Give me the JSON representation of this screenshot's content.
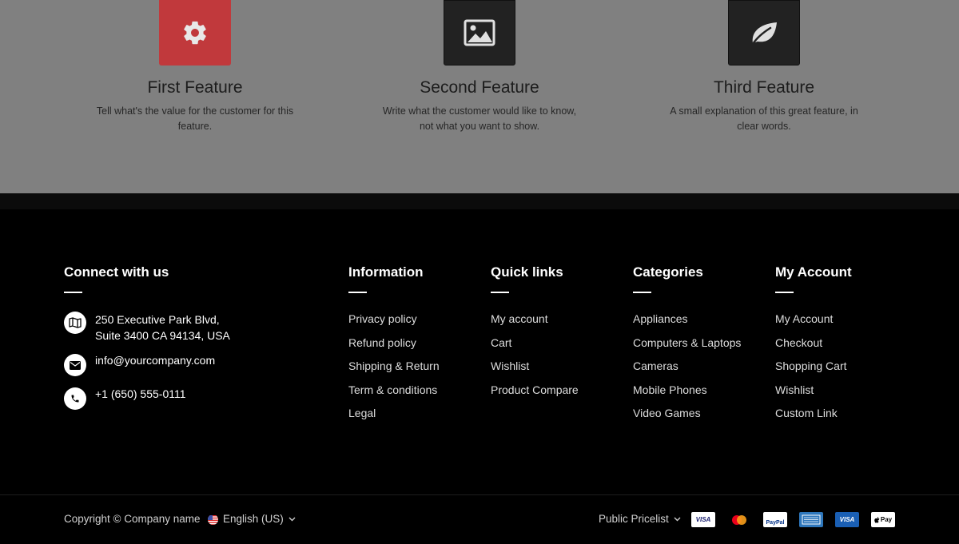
{
  "features": [
    {
      "title": "First Feature",
      "description": "Tell what's the value for the customer for this feature.",
      "icon": "gear-icon",
      "color": "#c1393c"
    },
    {
      "title": "Second Feature",
      "description": "Write what the customer would like to know, not what you want to show.",
      "icon": "image-icon",
      "color": "#222222"
    },
    {
      "title": "Third Feature",
      "description": "A small explanation of this great feature, in clear words.",
      "icon": "leaf-icon",
      "color": "#222222"
    }
  ],
  "footer": {
    "connect": {
      "heading": "Connect with us",
      "address": "250 Executive Park Blvd,\nSuite 3400 CA 94134, USA",
      "email": "info@yourcompany.com",
      "phone": "+1 (650) 555-0111"
    },
    "information": {
      "heading": "Information",
      "links": [
        "Privacy policy",
        "Refund policy",
        "Shipping & Return",
        "Term & conditions",
        "Legal"
      ]
    },
    "quick_links": {
      "heading": "Quick links",
      "links": [
        "My account",
        "Cart",
        "Wishlist",
        "Product Compare"
      ]
    },
    "categories": {
      "heading": "Categories",
      "links": [
        "Appliances",
        "Computers & Laptops",
        "Cameras",
        "Mobile Phones",
        "Video Games"
      ]
    },
    "my_account": {
      "heading": "My Account",
      "links": [
        "My Account",
        "Checkout",
        "Shopping Cart",
        "Wishlist",
        "Custom Link"
      ]
    }
  },
  "bottom": {
    "copyright": "Copyright © Company name",
    "language": "English (US)",
    "pricelist": "Public Pricelist",
    "payment_icons": [
      "visa-icon",
      "mastercard-icon",
      "paypal-icon",
      "amex-icon",
      "visa-electron-icon",
      "apple-pay-icon"
    ],
    "payment_labels": {
      "visa": "VISA",
      "paypal": "PayPal",
      "visa2": "VISA",
      "applepay": "Pay"
    }
  }
}
